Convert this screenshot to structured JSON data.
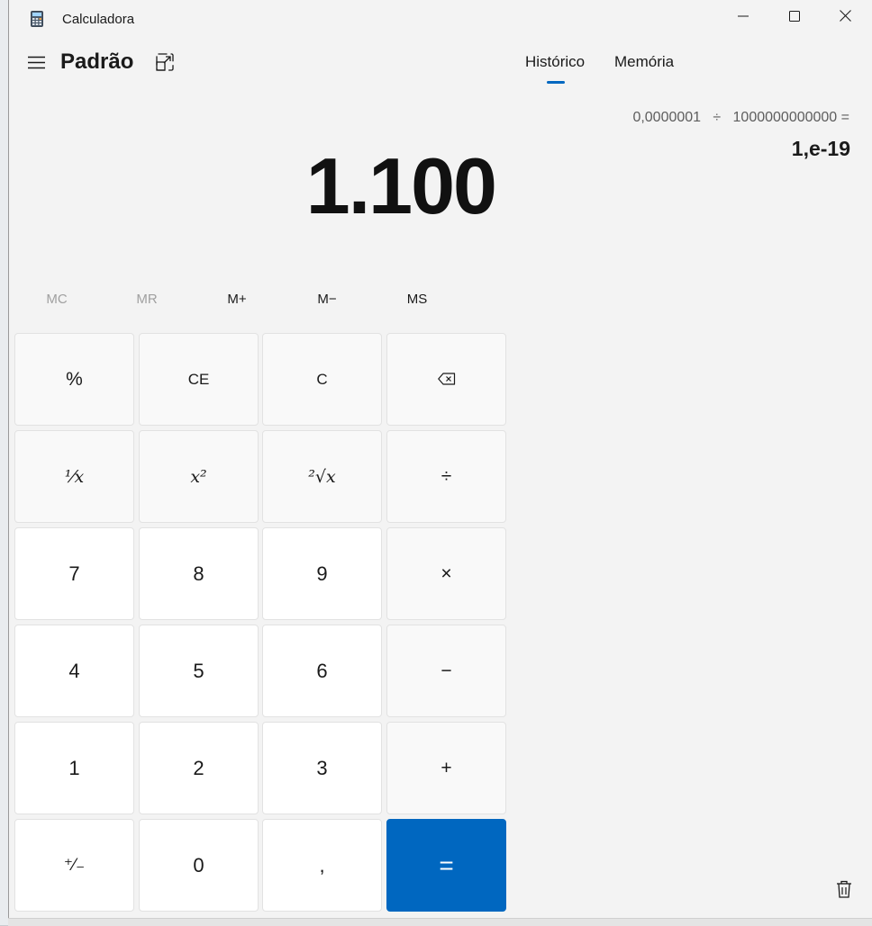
{
  "window": {
    "title": "Calculadora",
    "controls": {
      "minimize": "minimize-icon",
      "maximize": "maximize-icon",
      "close": "close-icon"
    }
  },
  "header": {
    "mode": "Padrão",
    "tabs": [
      {
        "label": "Histórico",
        "active": true
      },
      {
        "label": "Memória",
        "active": false
      }
    ]
  },
  "display": {
    "value": "1.100"
  },
  "history": {
    "expression": "0,0000001   ÷   1000000000000 =",
    "result": "1,e-19"
  },
  "memory": {
    "buttons": [
      {
        "label": "MC",
        "enabled": false
      },
      {
        "label": "MR",
        "enabled": false
      },
      {
        "label": "M+",
        "enabled": true
      },
      {
        "label": "M−",
        "enabled": true
      },
      {
        "label": "MS",
        "enabled": true
      }
    ]
  },
  "keypad": {
    "percent": "%",
    "clear_entry": "CE",
    "clear": "C",
    "backspace": "backspace-icon",
    "reciprocal": "¹⁄x",
    "square": "x²",
    "sqrt": "²√x",
    "divide": "÷",
    "seven": "7",
    "eight": "8",
    "nine": "9",
    "multiply": "×",
    "four": "4",
    "five": "5",
    "six": "6",
    "minus": "−",
    "one": "1",
    "two": "2",
    "three": "3",
    "plus": "+",
    "negate": "⁺⁄₋",
    "zero": "0",
    "decimal": ",",
    "equals": "="
  },
  "colors": {
    "accent": "#0067c0",
    "background": "#f3f3f3",
    "key_number": "#ffffff",
    "key_function": "#f9f9f9"
  }
}
